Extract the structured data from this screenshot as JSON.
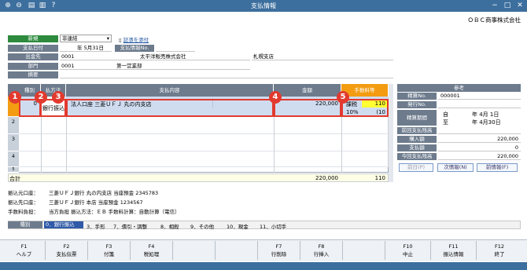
{
  "window": {
    "title": "支払情報"
  },
  "toolbar_icons": [
    "search-plus-icon",
    "search-minus-icon",
    "print-icon",
    "export-icon",
    "help-icon"
  ],
  "company": "ＯＢＣ商事株式会社",
  "header": {
    "mode_label": "新規",
    "mode_value": "非連結",
    "attach_link": "証憑を添付",
    "date_label": "支払日付",
    "date_value": "年  5月31日",
    "pay_no_label": "支払情報No.",
    "payee_label": "出金先",
    "payee_code": "0001",
    "payee_name": "太平洋販売株式会社",
    "payee_branch": "札幌支店",
    "dept_label": "部門",
    "dept_code": "0001",
    "dept_name": "第一営業部",
    "summary_label": "摘要"
  },
  "grid": {
    "columns": [
      "種別",
      "払方法",
      "支払内容",
      "金額",
      "手数料等"
    ],
    "rows": [
      {
        "num": "1",
        "kind": "0",
        "method": "銀行振込",
        "content": "法人口座  三菱ＵＦＪ  丸の内支店",
        "amount": "220,000",
        "fee_label": "課税",
        "fee_value": "110",
        "tax_rate": "10%",
        "tax_value": "(10"
      },
      {
        "num": "2"
      },
      {
        "num": "3"
      },
      {
        "num": "4"
      },
      {
        "num": "5"
      }
    ],
    "total_label": "合計",
    "total_amount": "220,000",
    "total_fee": "110"
  },
  "side": {
    "title": "参考",
    "settle_no_label": "精算No.",
    "settle_no_value": "000001",
    "issue_no_label": "発行No.",
    "period_label": "精算期間",
    "period_from_prefix": "自",
    "period_from": "年  4月 1日",
    "period_to_prefix": "至",
    "period_to": "年  4月30日",
    "prev_balance_label": "前回支払残高",
    "purchase_label": "購入額",
    "purchase_value": "220,000",
    "paid_label": "支払額",
    "paid_value": "0",
    "balance_label": "今回支払残高",
    "balance_value": "220,000",
    "btn_prev": "前日(P)",
    "btn_next": "次情報(N)",
    "btn_prev_info": "前情報(F)"
  },
  "info": {
    "src_label": "振込元口座：",
    "src_value": "三菱ＵＦＪ銀行 丸の内支店 当座預金 2345783",
    "dst_label": "振込先口座：",
    "dst_value": "三菱ＵＦＪ銀行 本店 当座預金 1234567",
    "fee_label": "手数料負担：",
    "fee_value": "当方負担    振込方法：ＥＢ    手数料計算：自動計算（電信）"
  },
  "legend": {
    "label": "種別",
    "items": [
      "0．銀行振込",
      "3．手形",
      "7．債引・調整",
      "8．相殺",
      "9．その他",
      "10．現金",
      "11．小切手"
    ]
  },
  "fkeys": [
    {
      "key": "F1",
      "label": "ヘルプ"
    },
    {
      "key": "F2",
      "label": "支払伝票"
    },
    {
      "key": "F3",
      "label": "付箋"
    },
    {
      "key": "F4",
      "label": "税処理"
    },
    {
      "key": "",
      "label": ""
    },
    {
      "key": "",
      "label": ""
    },
    {
      "key": "F7",
      "label": "行削除"
    },
    {
      "key": "F8",
      "label": "行挿入"
    },
    {
      "key": "",
      "label": ""
    },
    {
      "key": "F10",
      "label": "中止"
    },
    {
      "key": "F11",
      "label": "振込情報"
    },
    {
      "key": "F12",
      "label": "終了"
    }
  ],
  "markers": [
    "1",
    "2",
    "3",
    "4",
    "5"
  ],
  "colors": {
    "titlebar": "#3d6f9e",
    "header_label": "#6d7b8d",
    "new_label": "#2e8b3e",
    "fee_header": "#f39c12",
    "marker": "#e23a2e",
    "selected_row": "#cfdcf0",
    "fee_highlight": "#ffff33"
  }
}
